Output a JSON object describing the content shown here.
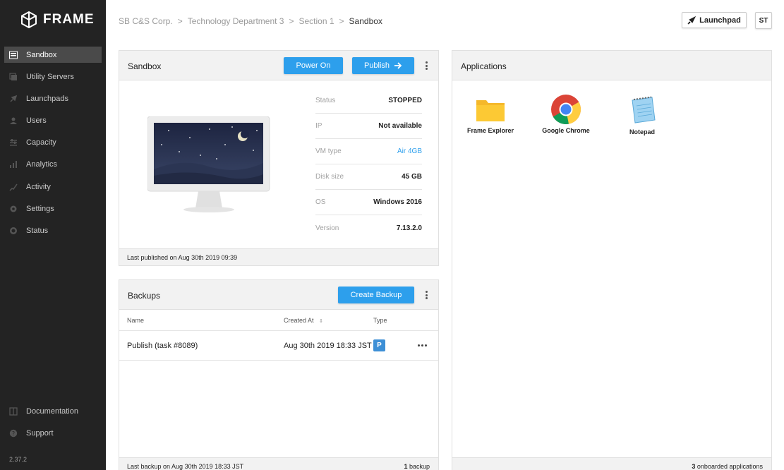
{
  "sidebar": {
    "brand": "FRAME",
    "items": [
      {
        "label": "Sandbox",
        "icon": "sandbox-icon",
        "active": true
      },
      {
        "label": "Utility Servers",
        "icon": "servers-icon"
      },
      {
        "label": "Launchpads",
        "icon": "launchpads-icon"
      },
      {
        "label": "Users",
        "icon": "users-icon"
      },
      {
        "label": "Capacity",
        "icon": "capacity-icon"
      },
      {
        "label": "Analytics",
        "icon": "analytics-icon"
      },
      {
        "label": "Activity",
        "icon": "activity-icon"
      },
      {
        "label": "Settings",
        "icon": "settings-icon"
      },
      {
        "label": "Status",
        "icon": "status-icon"
      }
    ],
    "bottom_items": [
      {
        "label": "Documentation",
        "icon": "book-icon"
      },
      {
        "label": "Support",
        "icon": "help-icon"
      }
    ],
    "version": "2.37.2"
  },
  "header": {
    "breadcrumb": [
      "SB C&S Corp.",
      "Technology Department 3",
      "Section 1",
      "Sandbox"
    ],
    "separator": ">",
    "launchpad_label": "Launchpad",
    "avatar": "ST"
  },
  "sandbox": {
    "title": "Sandbox",
    "power_on_label": "Power On",
    "publish_label": "Publish",
    "details": [
      {
        "key": "Status",
        "value": "STOPPED"
      },
      {
        "key": "IP",
        "value": "Not available"
      },
      {
        "key": "VM type",
        "value": "Air 4GB"
      },
      {
        "key": "Disk size",
        "value": "45 GB"
      },
      {
        "key": "OS",
        "value": "Windows 2016"
      },
      {
        "key": "Version",
        "value": "7.13.2.0"
      }
    ],
    "footer": "Last published on Aug 30th 2019 09:39"
  },
  "backups": {
    "title": "Backups",
    "create_label": "Create Backup",
    "columns": {
      "name": "Name",
      "created": "Created At",
      "sort_icon": "⇕",
      "type": "Type"
    },
    "rows": [
      {
        "name": "Publish (task #8089)",
        "created": "Aug 30th 2019 18:33 JST",
        "type": "P"
      }
    ],
    "footer_left": "Last backup on Aug 30th 2019 18:33 JST",
    "footer_count": "1",
    "footer_unit": " backup"
  },
  "applications": {
    "title": "Applications",
    "apps": [
      {
        "label": "Frame Explorer",
        "icon": "folder-icon"
      },
      {
        "label": "Google Chrome",
        "icon": "chrome-icon"
      },
      {
        "label": "Notepad",
        "icon": "notepad-icon"
      }
    ],
    "footer_count": "3",
    "footer_unit": " onboarded applications"
  },
  "colors": {
    "accent": "#2d9fec",
    "sidebar_bg": "#232323",
    "badge": "#3d8fd6"
  }
}
